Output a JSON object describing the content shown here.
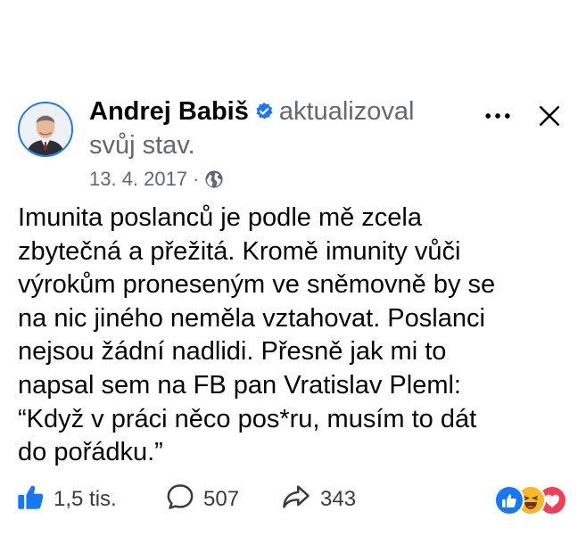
{
  "post": {
    "author": "Andrej Babiš",
    "action_inline": "aktualizoval",
    "action_continued": "svůj stav.",
    "date": "13. 4. 2017",
    "meta_separator": "·",
    "privacy_icon": "globe-icon",
    "text_lines": [
      "Imunita poslanců je podle mě zcela",
      "zbytečná a přežitá. Kromě imunity vůči",
      "výrokům proneseným ve sněmovně by se",
      "na nic jiného neměla vztahovat. Poslanci",
      "nejsou žádní nadlidi. Přesně jak mi to",
      "napsal sem na FB pan Vratislav Pleml:",
      "“Když v práci něco pos*ru, musím to dát",
      "do pořádku.”"
    ]
  },
  "header": {
    "more_icon": "more-dots-icon",
    "close_icon": "close-icon"
  },
  "stats": {
    "likes": "1,5 tis.",
    "comments": "507",
    "shares": "343"
  },
  "reactions": [
    "like",
    "haha",
    "love"
  ],
  "colors": {
    "facebook_blue": "#1877f2",
    "text_primary": "#050505",
    "text_secondary": "#65676b",
    "love_red": "#f33e58",
    "haha_yellow": "#f7b928"
  }
}
